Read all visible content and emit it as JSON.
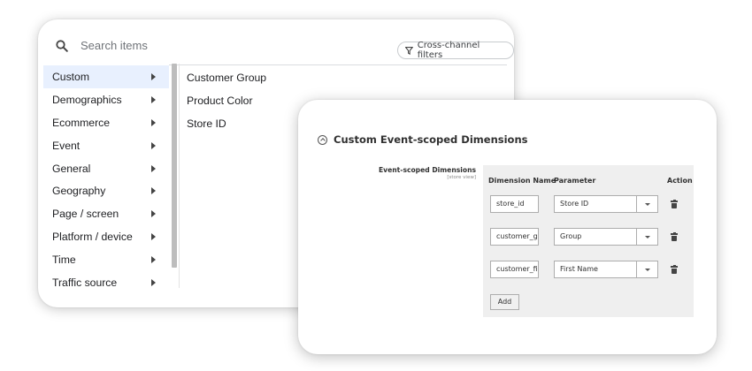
{
  "picker": {
    "search_placeholder": "Search items",
    "filter_label": "Cross-channel filters",
    "categories": [
      {
        "label": "Custom",
        "selected": true
      },
      {
        "label": "Demographics"
      },
      {
        "label": "Ecommerce"
      },
      {
        "label": "Event"
      },
      {
        "label": "General"
      },
      {
        "label": "Geography"
      },
      {
        "label": "Page / screen"
      },
      {
        "label": "Platform / device"
      },
      {
        "label": "Time"
      },
      {
        "label": "Traffic source"
      }
    ],
    "items": [
      "Customer Group",
      "Product Color",
      "Store ID"
    ]
  },
  "config": {
    "section_title": "Custom Event-scoped Dimensions",
    "field_label": "Event-scoped Dimensions",
    "field_scope": "[store view]",
    "headers": {
      "name": "Dimension Name",
      "parameter": "Parameter",
      "action": "Action"
    },
    "rows": [
      {
        "name": "store_id",
        "parameter": "Store ID"
      },
      {
        "name": "customer_g",
        "parameter": "Group"
      },
      {
        "name": "customer_fi",
        "parameter": "First Name"
      }
    ],
    "add_label": "Add"
  },
  "icons": {
    "search": "search-icon",
    "filter": "filter-funnel-icon",
    "category_arrow": "chevron-right-icon",
    "collapse": "collapse-circle-icon",
    "select_arrow": "dropdown-arrow-icon",
    "delete": "trash-icon"
  },
  "colors": {
    "selected_bg": "#e8f0fe",
    "table_bg": "#efefef"
  }
}
